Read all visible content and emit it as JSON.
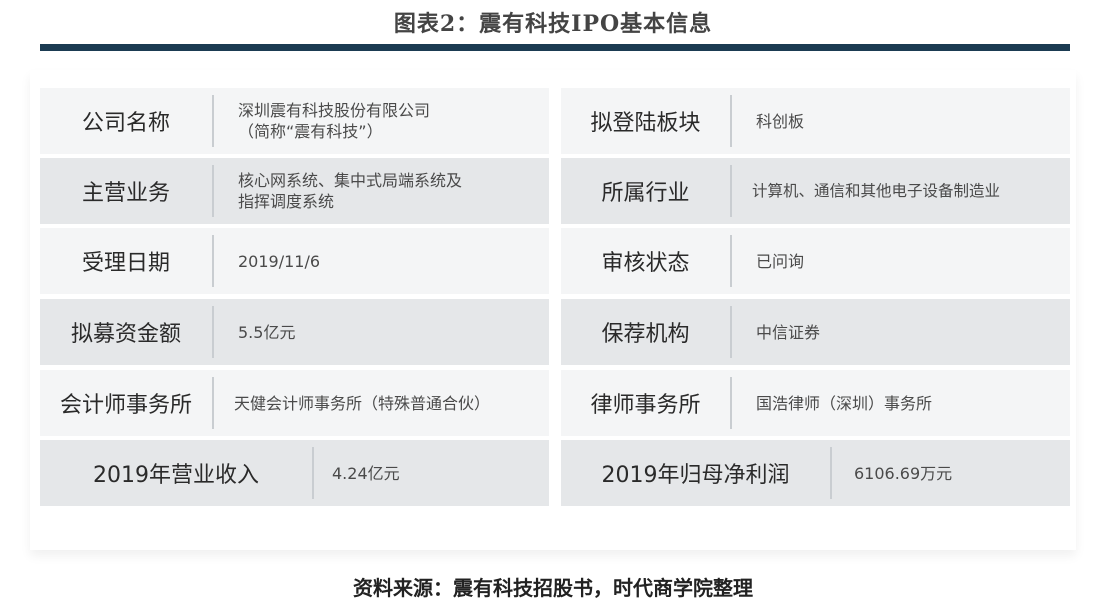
{
  "title": "图表2：震有科技IPO基本信息",
  "source": "资料来源：震有科技招股书，时代商学院整理",
  "rows": [
    {
      "left": {
        "label": "公司名称",
        "value": "深圳震有科技股份有限公司\n（简称“震有科技”）"
      },
      "right": {
        "label": "拟登陆板块",
        "value": "科创板"
      }
    },
    {
      "left": {
        "label": "主营业务",
        "value": "核心网系统、集中式局端系统及\n指挥调度系统"
      },
      "right": {
        "label": "所属行业",
        "value": "计算机、通信和其他电子设备制造业"
      }
    },
    {
      "left": {
        "label": "受理日期",
        "value": "2019/11/6"
      },
      "right": {
        "label": "审核状态",
        "value": "已问询"
      }
    },
    {
      "left": {
        "label": "拟募资金额",
        "value": "5.5亿元"
      },
      "right": {
        "label": "保荐机构",
        "value": "中信证券"
      }
    },
    {
      "left": {
        "label": "会计师事务所",
        "value": "天健会计师事务所（特殊普通合伙）"
      },
      "right": {
        "label": "律师事务所",
        "value": "国浩律师（深圳）事务所"
      }
    },
    {
      "left": {
        "label": "2019年营业收入",
        "value": "4.24亿元"
      },
      "right": {
        "label": "2019年归母净利润",
        "value": "6106.69万元"
      }
    }
  ]
}
